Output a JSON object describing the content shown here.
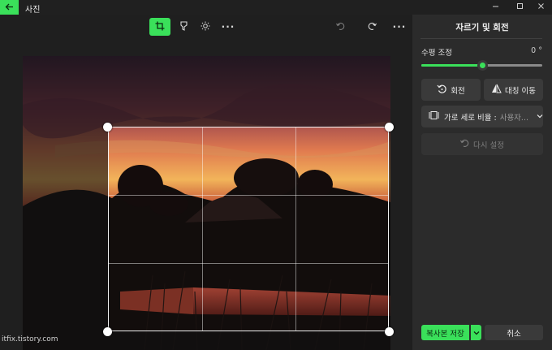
{
  "window": {
    "title": "사진",
    "controls": [
      "minimize-icon",
      "maximize-icon",
      "close-icon"
    ]
  },
  "toolbar": {
    "items": [
      "crop-icon",
      "adjust-icon",
      "filter-icon",
      "more-icon",
      "undo-icon",
      "redo-icon",
      "more-icon"
    ],
    "more_label": "···"
  },
  "panel": {
    "title": "자르기 및 회전",
    "straighten": {
      "label": "수평 조정",
      "value": "0 °",
      "level": 0.5
    },
    "rotate_label": "회전",
    "flip_label": "대칭 이동",
    "aspect_label": "가로 세로 비율 : ",
    "aspect_value": "사용자...",
    "reset_label": "다시 설정",
    "save_label": "복사본 저장",
    "cancel_label": "취소"
  },
  "watermark": "itfix.tistory.com",
  "colors": {
    "accent": "#3ae05a",
    "panel": "#2b2b2b",
    "background": "#1f1f1f"
  }
}
